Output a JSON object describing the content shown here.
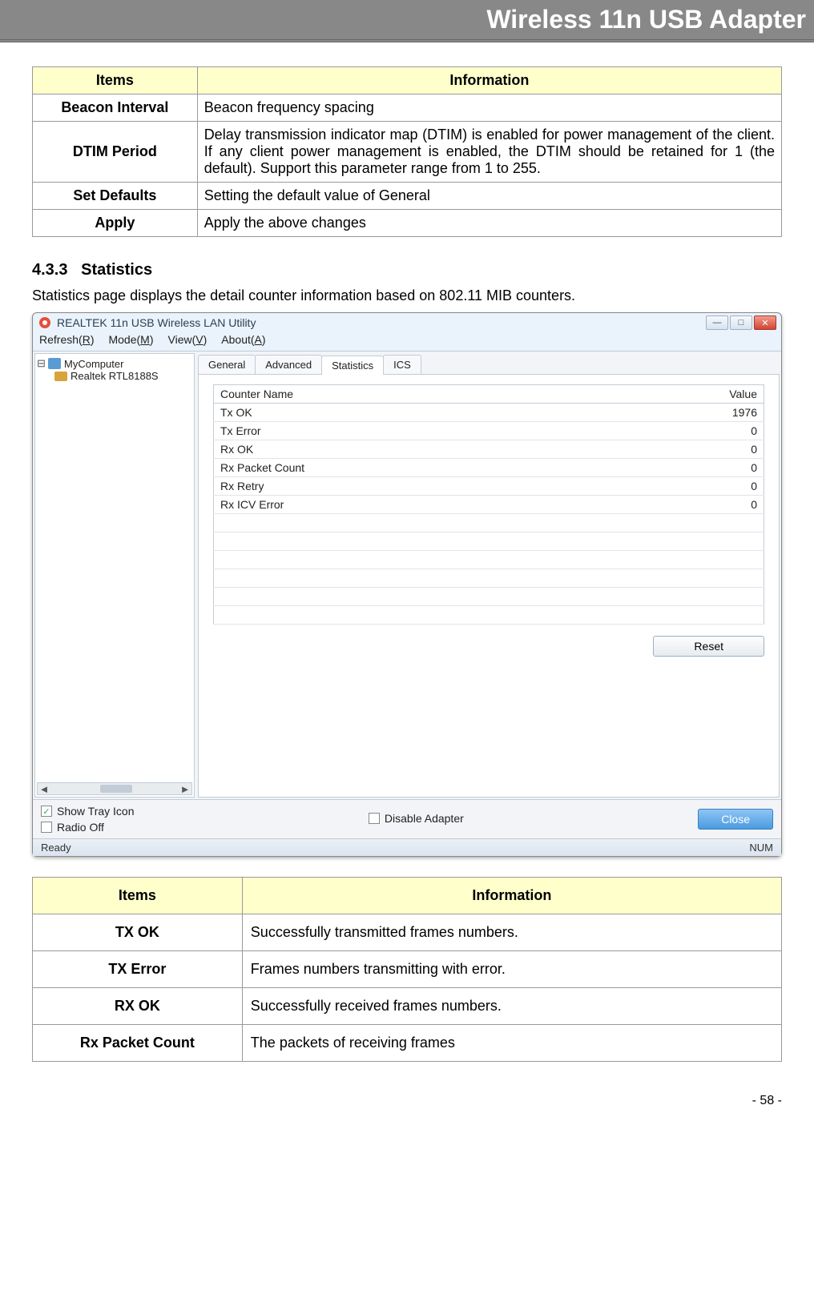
{
  "page_header": "Wireless 11n USB Adapter",
  "table1": {
    "headers": [
      "Items",
      "Information"
    ],
    "rows": [
      {
        "item": "Beacon Interval",
        "info": "Beacon frequency spacing"
      },
      {
        "item": "DTIM Period",
        "info": "Delay transmission indicator map (DTIM) is enabled for power management of the client. If any client power management is enabled, the DTIM should be retained for 1 (the default). Support this parameter range from 1 to 255."
      },
      {
        "item": "Set Defaults",
        "info": "Setting the default value of General"
      },
      {
        "item": "Apply",
        "info": "Apply the above changes"
      }
    ]
  },
  "section": {
    "number": "4.3.3",
    "title": "Statistics",
    "desc": "Statistics page displays the detail counter information based on 802.11 MIB counters."
  },
  "app": {
    "title": "REALTEK 11n USB Wireless LAN Utility",
    "menu": {
      "refresh_label": "Refresh(",
      "refresh_u": "R",
      "refresh_suffix": ")",
      "mode_label": "Mode(",
      "mode_u": "M",
      "mode_suffix": ")",
      "view_label": "View(",
      "view_u": "V",
      "view_suffix": ")",
      "about_label": "About(",
      "about_u": "A",
      "about_suffix": ")"
    },
    "tree": {
      "root": "MyComputer",
      "child": "Realtek RTL8188S"
    },
    "tabs": [
      "General",
      "Advanced",
      "Statistics",
      "ICS"
    ],
    "active_tab": 2,
    "stats_headers": [
      "Counter Name",
      "Value"
    ],
    "stats_rows": [
      {
        "name": "Tx OK",
        "value": "1976"
      },
      {
        "name": "Tx Error",
        "value": "0"
      },
      {
        "name": "Rx OK",
        "value": "0"
      },
      {
        "name": "Rx Packet Count",
        "value": "0"
      },
      {
        "name": "Rx Retry",
        "value": "0"
      },
      {
        "name": "Rx ICV Error",
        "value": "0"
      }
    ],
    "reset_label": "Reset",
    "show_tray_label": "Show Tray Icon",
    "show_tray_checked": true,
    "radio_off_label": "Radio Off",
    "radio_off_checked": false,
    "disable_adapter_label": "Disable Adapter",
    "disable_adapter_checked": false,
    "close_label": "Close",
    "status_left": "Ready",
    "status_right": "NUM"
  },
  "table2": {
    "headers": [
      "Items",
      "Information"
    ],
    "rows": [
      {
        "item": "TX OK",
        "info": "Successfully transmitted frames numbers."
      },
      {
        "item": "TX Error",
        "info": "Frames numbers transmitting with error."
      },
      {
        "item": "RX OK",
        "info": "Successfully received frames numbers."
      },
      {
        "item": "Rx Packet Count",
        "info": "The packets of receiving frames"
      }
    ]
  },
  "page_number": "- 58 -"
}
